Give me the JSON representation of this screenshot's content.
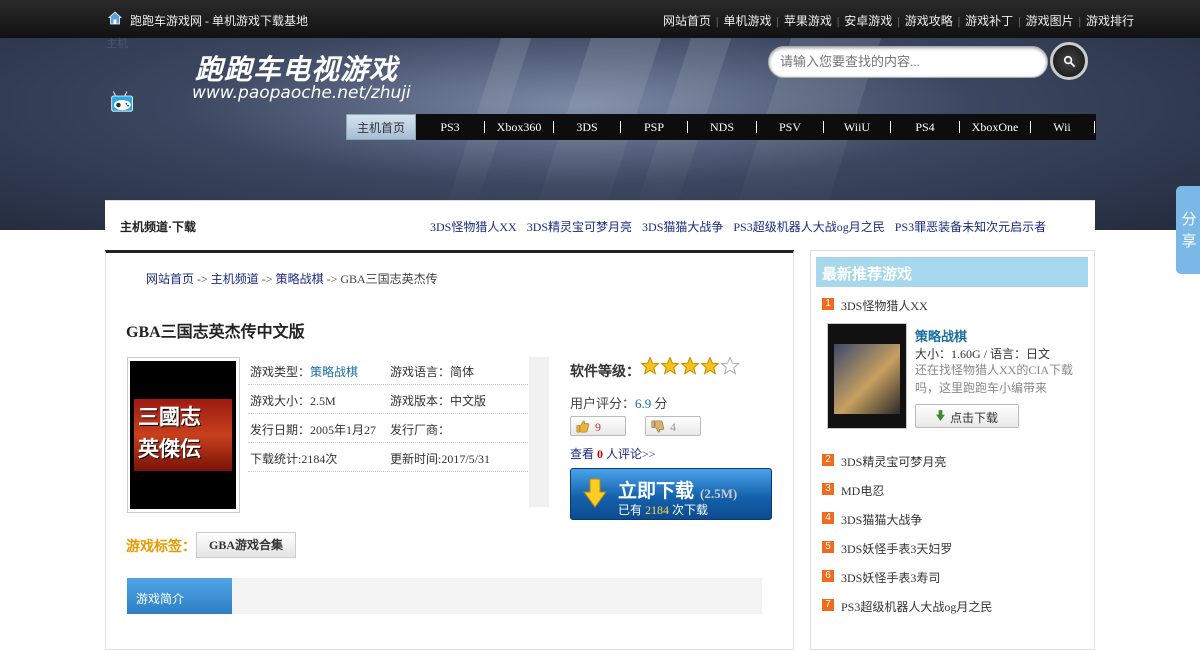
{
  "topbar": {
    "site_title": "跑跑车游戏网 - 单机游戏下载基地",
    "nav": [
      "网站首页",
      "单机游戏",
      "苹果游戏",
      "安卓游戏",
      "游戏攻略",
      "游戏补丁",
      "游戏图片",
      "游戏排行"
    ]
  },
  "header": {
    "logo_text": "跑跑车电视游戏",
    "logo_url": "www.paopaoche.net/zhuji",
    "logo_small": "主机",
    "search_placeholder": "请输入您要查找的内容..."
  },
  "platform_nav": [
    "主机首页",
    "PS3",
    "Xbox360",
    "3DS",
    "PSP",
    "NDS",
    "PSV",
    "WiiU",
    "PS4",
    "XboxOne",
    "Wii"
  ],
  "channel": {
    "title": "主机频道·下载",
    "links": [
      "3DS怪物猎人XX",
      "3DS精灵宝可梦月亮",
      "3DS猫猫大战争",
      "PS3超级机器人大战og月之民",
      "PS3罪恶装备未知次元启示者"
    ]
  },
  "breadcrumb": {
    "home": "网站首页",
    "sep": "->",
    "channel": "主机频道",
    "category": "策略战棋",
    "current": "GBA三国志英杰传"
  },
  "game": {
    "title": "GBA三国志英杰传中文版",
    "cover_text": "三國志英傑伝",
    "type_label": "游戏类型：",
    "type_value": "策略战棋",
    "language": "游戏语言：简体",
    "size": "游戏大小：2.5M",
    "version": "游戏版本：中文版",
    "release": "发行日期：2005年1月27",
    "publisher": "发行厂商：",
    "downloads": "下载统计:2184次",
    "updated": "更新时间:2017/5/31",
    "rating_label": "软件等级：",
    "rating_stars": 4,
    "rating_max": 5,
    "user_score_label": "用户评分：",
    "user_score_value": "6.9",
    "user_score_unit": "分",
    "likes": "9",
    "dislikes": "4",
    "comments_prefix": "查看",
    "comments_count": "0",
    "comments_suffix": "人评论>>",
    "download_label": "立即下载",
    "download_size": "(2.5M)",
    "download_count_prefix": "已有",
    "download_count": "2184",
    "download_count_suffix": "次下载",
    "tags_label": "游戏标签：",
    "tag": "GBA游戏合集",
    "intro_tab": "游戏简介"
  },
  "sidebar": {
    "title": "最新推荐游戏",
    "featured": {
      "category": "策略战棋",
      "meta": "大小：1.60G / 语言：日文",
      "desc": "还在找怪物猎人XX的CIA下载吗，这里跑跑车小编带来",
      "download_label": "点击下载"
    },
    "items": [
      {
        "num": "1",
        "name": "3DS怪物猎人XX"
      },
      {
        "num": "2",
        "name": "3DS精灵宝可梦月亮"
      },
      {
        "num": "3",
        "name": "MD电忍"
      },
      {
        "num": "4",
        "name": "3DS猫猫大战争"
      },
      {
        "num": "5",
        "name": "3DS妖怪手表3天妇罗"
      },
      {
        "num": "6",
        "name": "3DS妖怪手表3寿司"
      },
      {
        "num": "7",
        "name": "PS3超级机器人大战og月之民"
      }
    ]
  },
  "share": {
    "label": "分享"
  },
  "colors": {
    "accent_blue": "#1a6ea0",
    "link_navy": "#1a2a80",
    "rank_orange": "#f26b1d",
    "tag_orange": "#e89a00"
  }
}
